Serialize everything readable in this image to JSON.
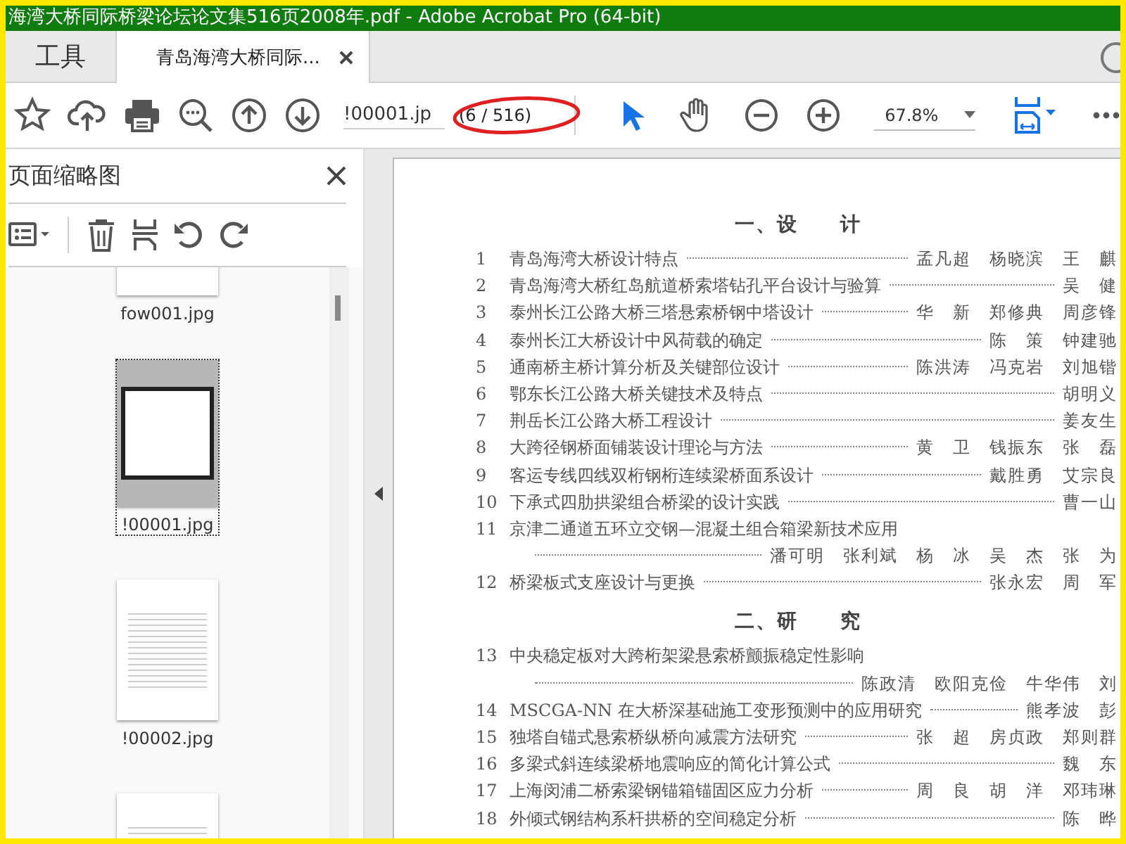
{
  "window": {
    "title": "海湾大桥同际桥梁论坛论文集516页2008年.pdf - Adobe Acrobat Pro (64-bit)"
  },
  "tabs": [
    {
      "label": "工具",
      "kind": "home",
      "selected": false
    },
    {
      "label": "青岛海湾大桥同际...",
      "kind": "document",
      "selected": true
    }
  ],
  "toolbar": {
    "page_field": {
      "value": "!00001.jp"
    },
    "page_count": "(6 / 516)",
    "zoom": {
      "value": "67.8%"
    },
    "tools": [
      {
        "kind": "select",
        "selected": true
      },
      {
        "kind": "hand",
        "selected": false
      }
    ]
  },
  "thumbnails_panel": {
    "title": "页面缩略图",
    "items": [
      {
        "label": "fow001.jpg",
        "selected": false
      },
      {
        "label": "!00001.jpg",
        "selected": true
      },
      {
        "label": "!00002.jpg",
        "selected": false
      },
      {
        "selected": false
      }
    ]
  },
  "document": {
    "sections": [
      {
        "heading": "一、设　　计",
        "entries": [
          {
            "number": "1",
            "title": "青岛海湾大桥设计特点",
            "authors": "孟凡超　杨晓滨　王　麒",
            "kind": "single"
          },
          {
            "number": "2",
            "title": "青岛海湾大桥红岛航道桥索塔钻孔平台设计与验算",
            "authors": "吴　健",
            "kind": "single"
          },
          {
            "number": "3",
            "title": "泰州长江公路大桥三塔悬索桥钢中塔设计",
            "authors": "华　新　郑修典　周彦锋",
            "kind": "single"
          },
          {
            "number": "4",
            "title": "泰州长江大桥设计中风荷载的确定",
            "authors": "陈　策　钟建驰",
            "kind": "single"
          },
          {
            "number": "5",
            "title": "通南桥主桥计算分析及关键部位设计",
            "authors": "陈洪涛　冯克岩　刘旭锴",
            "kind": "single"
          },
          {
            "number": "6",
            "title": "鄂东长江公路大桥关键技术及特点",
            "authors": "胡明义",
            "kind": "single"
          },
          {
            "number": "7",
            "title": "荆岳长江公路大桥工程设计",
            "authors": "姜友生",
            "kind": "single"
          },
          {
            "number": "8",
            "title": "大跨径钢桥面铺装设计理论与方法",
            "authors": "黄　卫　钱振东　张　磊",
            "kind": "single"
          },
          {
            "number": "9",
            "title": "客运专线四线双桁钢桁连续梁桥面系设计",
            "authors": "戴胜勇　艾宗良",
            "kind": "single"
          },
          {
            "number": "10",
            "title": "下承式四肋拱梁组合桥梁的设计实践",
            "authors": "曹一山",
            "kind": "single"
          },
          {
            "number": "11",
            "title": "京津二通道五环立交钢—混凝土组合箱梁新技术应用",
            "authors": "潘可明　张利斌　杨　冰　吴　杰　张　为",
            "kind": "wrapped"
          },
          {
            "number": "12",
            "title": "桥梁板式支座设计与更换",
            "authors": "张永宏　周　军",
            "kind": "single"
          }
        ]
      },
      {
        "heading": "二、研　　究",
        "entries": [
          {
            "number": "13",
            "title": "中央稳定板对大跨桁架梁悬索桥颤振稳定性影响",
            "authors": "陈政清　欧阳克俭　牛华伟　刘",
            "kind": "wrapped"
          },
          {
            "number": "14",
            "title": "MSCGA-NN 在大桥深基础施工变形预测中的应用研究",
            "authors": "熊孝波　彭",
            "kind": "single"
          },
          {
            "number": "15",
            "title": "独塔自锚式悬索桥纵桥向减震方法研究",
            "authors": "张　超　房贞政　郑则群",
            "kind": "single"
          },
          {
            "number": "16",
            "title": "多梁式斜连续梁桥地震响应的简化计算公式",
            "authors": "魏　东",
            "kind": "single"
          },
          {
            "number": "17",
            "title": "上海闵浦二桥索梁钢锚箱锚固区应力分析",
            "authors": "周　良　胡　洋　邓玮琳",
            "kind": "single"
          },
          {
            "number": "18",
            "title": "外倾式钢结构系杆拱桥的空间稳定分析",
            "authors": "陈　晔",
            "kind": "single"
          }
        ]
      }
    ]
  }
}
